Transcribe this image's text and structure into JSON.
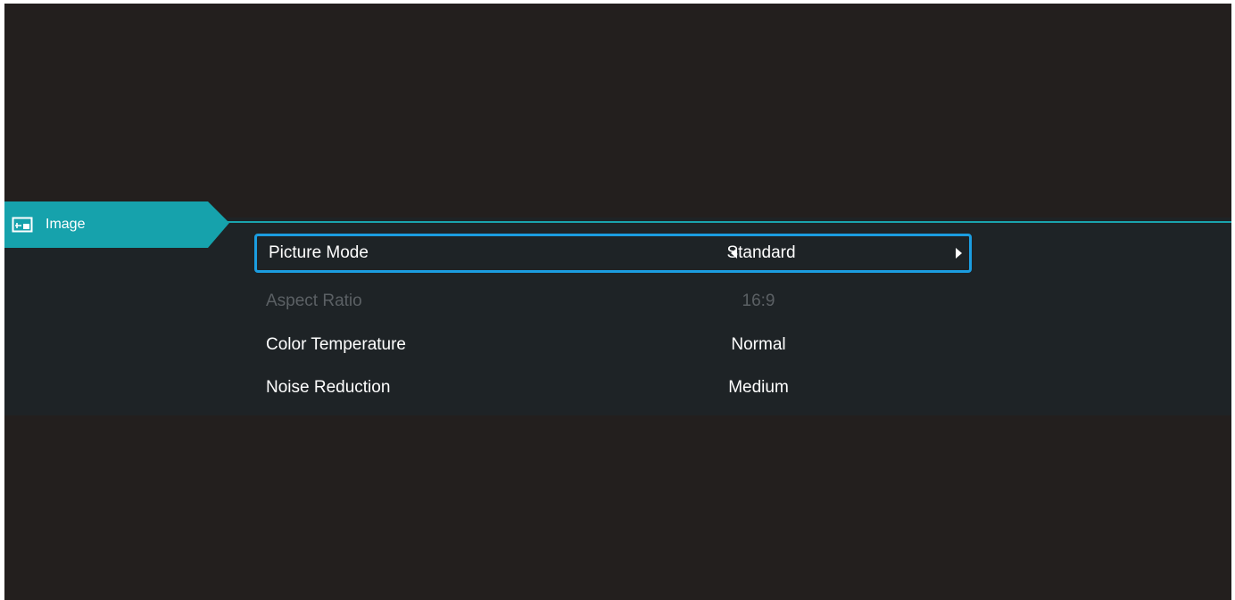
{
  "category": {
    "label": "Image",
    "icon": "picture-settings-icon"
  },
  "menu": {
    "items": [
      {
        "label": "Picture Mode",
        "value": "Standard",
        "selected": true,
        "enabled": true
      },
      {
        "label": "Aspect Ratio",
        "value": "16:9",
        "selected": false,
        "enabled": false
      },
      {
        "label": "Color Temperature",
        "value": "Normal",
        "selected": false,
        "enabled": true
      },
      {
        "label": "Noise Reduction",
        "value": "Medium",
        "selected": false,
        "enabled": true
      }
    ]
  },
  "colors": {
    "background": "#231f1e",
    "panel": "#1e2326",
    "accent": "#16a2ac",
    "selection_border": "#1b9de0",
    "disabled_text": "#5b6064"
  }
}
